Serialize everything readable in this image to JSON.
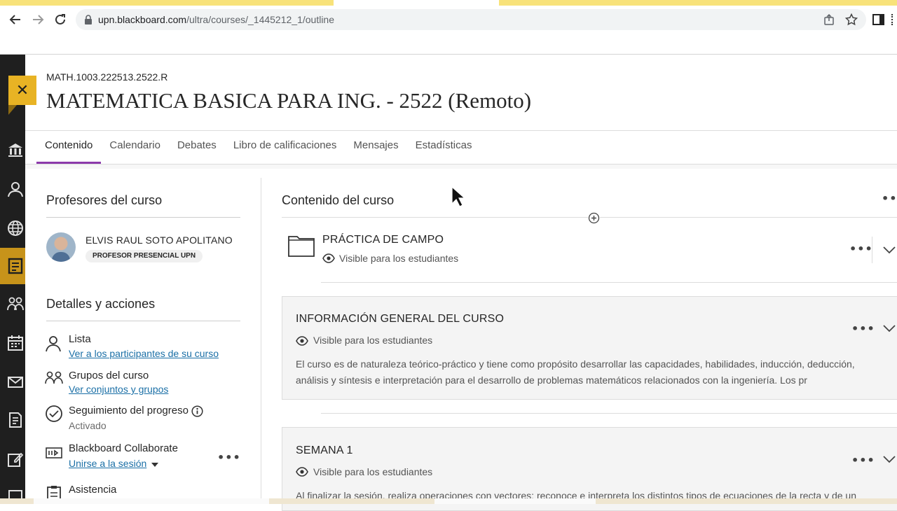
{
  "browser": {
    "url_host": "upn.blackboard.com",
    "url_path": "/ultra/courses/_1445212_1/outline"
  },
  "course": {
    "code": "MATH.1003.222513.2522.R",
    "title": "MATEMATICA BASICA PARA ING. - 2522 (Remoto)"
  },
  "tabs": [
    {
      "label": "Contenido",
      "active": true
    },
    {
      "label": "Calendario",
      "active": false
    },
    {
      "label": "Debates",
      "active": false
    },
    {
      "label": "Libro de calificaciones",
      "active": false
    },
    {
      "label": "Mensajes",
      "active": false
    },
    {
      "label": "Estadísticas",
      "active": false
    }
  ],
  "left_panel": {
    "professors_heading": "Profesores del curso",
    "professor_name": "ELVIS RAUL SOTO APOLITANO",
    "professor_badge": "PROFESOR PRESENCIAL UPN",
    "details_heading": "Detalles y acciones",
    "actions": [
      {
        "title": "Lista",
        "link": "Ver a los participantes de su curso",
        "icon": "person-icon"
      },
      {
        "title": "Grupos del curso",
        "link": "Ver conjuntos y grupos",
        "icon": "groups-icon"
      },
      {
        "title": "Seguimiento del progreso",
        "sub": "Activado",
        "icon": "check-circle-icon"
      },
      {
        "title": "Blackboard Collaborate",
        "link": "Unirse a la sesión",
        "icon": "collaborate-icon"
      },
      {
        "title": "Asistencia",
        "icon": "clipboard-icon"
      }
    ]
  },
  "content": {
    "heading": "Contenido del curso",
    "items": [
      {
        "title": "PRÁCTICA DE CAMPO",
        "visibility": "Visible para los estudiantes",
        "type": "folder"
      },
      {
        "title": "INFORMACIÓN GENERAL DEL CURSO",
        "visibility": "Visible para los estudiantes",
        "description": "El curso es de naturaleza teórico-práctico y tiene como propósito desarrollar las capacidades, habilidades, inducción, deducción, análisis y síntesis e interpretación para el desarrollo de problemas matemáticos relacionados con la ingeniería. Los pr"
      },
      {
        "title": "SEMANA 1",
        "visibility": "Visible para los estudiantes",
        "description": "Al finalizar la sesión, realiza operaciones con vectores; reconoce e interpreta los distintos tipos de ecuaciones de la recta y de un"
      }
    ]
  },
  "colors": {
    "accent": "#8c3aab",
    "close_button": "#e8b324",
    "link": "#1a6fa6",
    "nav_bg": "#1f1f1f"
  }
}
